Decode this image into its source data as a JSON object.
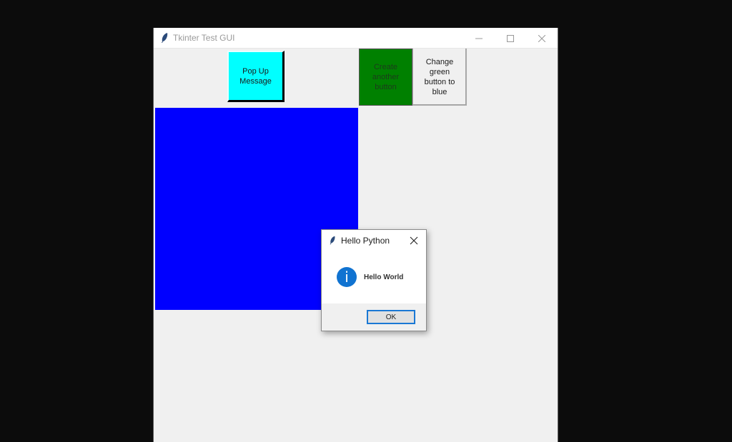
{
  "window": {
    "title": "Tkinter Test GUI",
    "icon": "feather-icon",
    "controls": [
      "minimize-icon",
      "maximize-icon",
      "close-icon"
    ]
  },
  "buttons": {
    "popup": "Pop Up Message",
    "create": "Create another button",
    "change": "Change green button to blue"
  },
  "colors": {
    "popup_bg": "#00ffff",
    "create_bg": "#008000",
    "canvas_bg": "#0000ff",
    "info_icon": "#1073d1"
  },
  "dialog": {
    "title": "Hello Python",
    "message": "Hello World",
    "icon": "info-icon",
    "ok_label": "OK",
    "info_glyph": "i"
  }
}
